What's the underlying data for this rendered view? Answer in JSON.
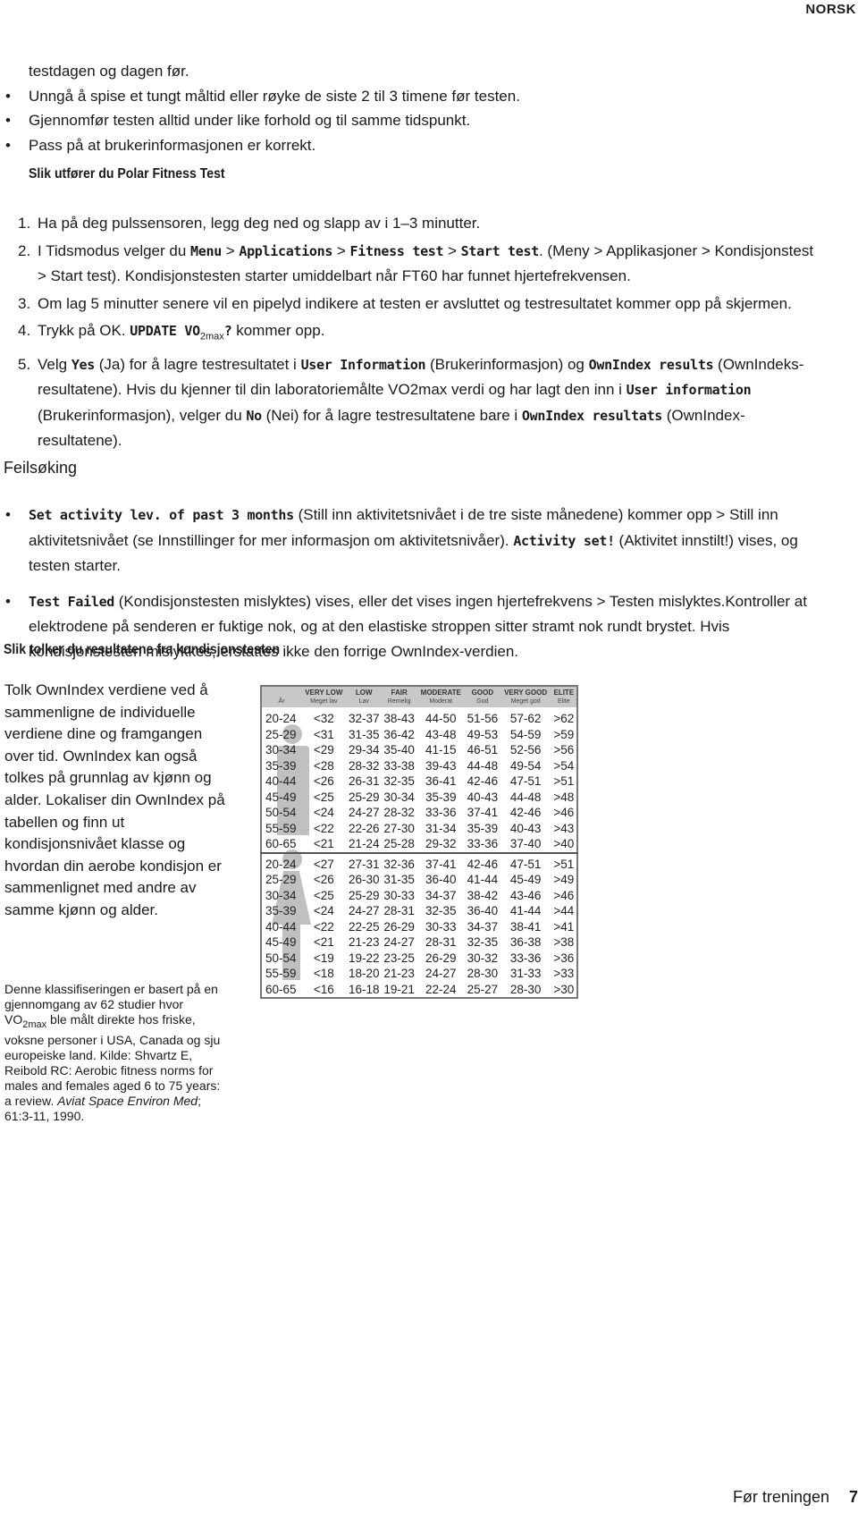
{
  "header": {
    "language": "NORSK"
  },
  "intro": [
    [
      {
        "t": "testdagen og dagen før."
      }
    ],
    [
      {
        "t": "Unngå å spise et tungt måltid eller røyke de siste 2 til 3 timene før testen."
      }
    ],
    [
      {
        "t": "Gjennomfør testen alltid under like forhold og til samme tidspunkt."
      }
    ],
    [
      {
        "t": "Pass på at brukerinformasjonen er korrekt."
      }
    ]
  ],
  "heading1": "Slik utfører du Polar Fitness Test",
  "steps": [
    {
      "n": "1.",
      "seg": [
        {
          "t": "Ha på deg pulssensoren, legg deg ned og slapp av i 1–3 minutter."
        }
      ]
    },
    {
      "n": "2.",
      "seg": [
        {
          "t": "I Tidsmodus velger du "
        },
        {
          "t": "Menu",
          "s": "lcd"
        },
        {
          "t": " > "
        },
        {
          "t": "Applications",
          "s": "lcd"
        },
        {
          "t": " > "
        },
        {
          "t": "Fitness test",
          "s": "lcd"
        },
        {
          "t": " > "
        },
        {
          "t": "Start test",
          "s": "lcd"
        },
        {
          "t": ". (Meny > Applikasjoner > Kondisjonstest > Start test). Kondisjonstesten starter umiddelbart når FT60 har funnet hjertefrekvensen."
        }
      ]
    },
    {
      "n": "3.",
      "seg": [
        {
          "t": "Om lag 5 minutter senere vil en pipelyd indikere at testen er avsluttet og testresultatet kommer opp på skjermen."
        }
      ]
    },
    {
      "n": "4.",
      "seg": [
        {
          "t": "Trykk på OK. "
        },
        {
          "t": "UPDATE VO",
          "s": "lcd"
        },
        {
          "t": "2max",
          "s": "sub"
        },
        {
          "t": "?",
          "s": "lcd"
        },
        {
          "t": " kommer opp."
        }
      ]
    },
    {
      "n": "5.",
      "seg": [
        {
          "t": "Velg "
        },
        {
          "t": "Yes",
          "s": "lcd"
        },
        {
          "t": " (Ja) for å lagre testresultatet i "
        },
        {
          "t": "User Information",
          "s": "lcd"
        },
        {
          "t": " (Brukerinformasjon) og "
        },
        {
          "t": "OwnIndex results",
          "s": "lcd"
        },
        {
          "t": " (OwnIndeks-resultatene). Hvis du kjenner til din laboratoriemålte VO2max verdi og har lagt den inn i "
        },
        {
          "t": "User information",
          "s": "lcd"
        },
        {
          "t": " (Brukerinformasjon), velger du "
        },
        {
          "t": "No",
          "s": "lcd"
        },
        {
          "t": " (Nei) for å lagre testresultatene bare i "
        },
        {
          "t": "OwnIndex resultats",
          "s": "lcd"
        },
        {
          "t": " (OwnIndex-resultatene)."
        }
      ]
    }
  ],
  "heading2": "Feilsøking",
  "troubleshooting": [
    [
      {
        "t": "Set activity lev. of past 3 months",
        "s": "lcd"
      },
      {
        "t": " (Still inn aktivitetsnivået i de tre siste månedene) kommer opp > Still inn aktivitetsnivået (se Innstillinger for mer informasjon om aktivitetsnivåer). "
      },
      {
        "t": "Activity set!",
        "s": "lcd"
      },
      {
        "t": " (Aktivitet innstilt!) vises, og testen starter."
      }
    ],
    [
      {
        "t": "Test Failed",
        "s": "lcd"
      },
      {
        "t": " (Kondisjonstesten mislyktes) vises, eller det vises ingen hjertefrekvens > Testen mislyktes.Kontroller at elektrodene på senderen er fuktige nok, og at den elastiske stroppen sitter stramt nok rundt brystet. Hvis kondisjonstesten mislykkes, erstattes ikke den forrige OwnIndex-verdien."
      }
    ]
  ],
  "heading3": "Slik tolker du resultatene fra kondisjonstesten",
  "interpretation": "Tolk OwnIndex verdiene ved å sammenligne de individuelle verdiene dine og framgangen over tid. OwnIndex kan også tolkes på grunnlag av kjønn og alder. Lokaliser din OwnIndex på tabellen og finn ut kondisjonsnivået klasse og hvordan din aerobe kondisjon er sammenlignet med andre av samme kjønn og alder.",
  "source_note": [
    {
      "t": "Denne klassifiseringen er basert på en gjennomgang av 62 studier hvor VO"
    },
    {
      "t": "2max",
      "s": "sub"
    },
    {
      "t": " ble målt direkte hos friske, voksne personer i USA, Canada og sju europeiske land. Kilde: Shvartz E, Reibold RC: Aerobic fitness norms for males and females aged 6 to 75 years: a review. "
    },
    {
      "t": "Aviat Space Environ Med",
      "s": "i"
    },
    {
      "t": "; 61:3-11, 1990."
    }
  ],
  "table": {
    "headers": [
      {
        "en": "",
        "no": "År"
      },
      {
        "en": "VERY LOW",
        "no": "Meget lav"
      },
      {
        "en": "LOW",
        "no": "Lav"
      },
      {
        "en": "FAIR",
        "no": "Remelig"
      },
      {
        "en": "MODERATE",
        "no": "Moderat"
      },
      {
        "en": "GOOD",
        "no": "God"
      },
      {
        "en": "VERY GOOD",
        "no": "Meget god"
      },
      {
        "en": "ELITE",
        "no": "Elite"
      }
    ],
    "male": [
      [
        "20-24",
        "<32",
        "32-37",
        "38-43",
        "44-50",
        "51-56",
        "57-62",
        ">62"
      ],
      [
        "25-29",
        "<31",
        "31-35",
        "36-42",
        "43-48",
        "49-53",
        "54-59",
        ">59"
      ],
      [
        "30-34",
        "<29",
        "29-34",
        "35-40",
        "41-15",
        "46-51",
        "52-56",
        ">56"
      ],
      [
        "35-39",
        "<28",
        "28-32",
        "33-38",
        "39-43",
        "44-48",
        "49-54",
        ">54"
      ],
      [
        "40-44",
        "<26",
        "26-31",
        "32-35",
        "36-41",
        "42-46",
        "47-51",
        ">51"
      ],
      [
        "45-49",
        "<25",
        "25-29",
        "30-34",
        "35-39",
        "40-43",
        "44-48",
        ">48"
      ],
      [
        "50-54",
        "<24",
        "24-27",
        "28-32",
        "33-36",
        "37-41",
        "42-46",
        ">46"
      ],
      [
        "55-59",
        "<22",
        "22-26",
        "27-30",
        "31-34",
        "35-39",
        "40-43",
        ">43"
      ],
      [
        "60-65",
        "<21",
        "21-24",
        "25-28",
        "29-32",
        "33-36",
        "37-40",
        ">40"
      ]
    ],
    "female": [
      [
        "20-24",
        "<27",
        "27-31",
        "32-36",
        "37-41",
        "42-46",
        "47-51",
        ">51"
      ],
      [
        "25-29",
        "<26",
        "26-30",
        "31-35",
        "36-40",
        "41-44",
        "45-49",
        ">49"
      ],
      [
        "30-34",
        "<25",
        "25-29",
        "30-33",
        "34-37",
        "38-42",
        "43-46",
        ">46"
      ],
      [
        "35-39",
        "<24",
        "24-27",
        "28-31",
        "32-35",
        "36-40",
        "41-44",
        ">44"
      ],
      [
        "40-44",
        "<22",
        "22-25",
        "26-29",
        "30-33",
        "34-37",
        "38-41",
        ">41"
      ],
      [
        "45-49",
        "<21",
        "21-23",
        "24-27",
        "28-31",
        "32-35",
        "36-38",
        ">38"
      ],
      [
        "50-54",
        "<19",
        "19-22",
        "23-25",
        "26-29",
        "30-32",
        "33-36",
        ">36"
      ],
      [
        "55-59",
        "<18",
        "18-20",
        "21-23",
        "24-27",
        "28-30",
        "31-33",
        ">33"
      ],
      [
        "60-65",
        "<16",
        "16-18",
        "19-21",
        "22-24",
        "25-27",
        "28-30",
        ">30"
      ]
    ]
  },
  "footer": {
    "section": "Før treningen",
    "page": "7"
  }
}
